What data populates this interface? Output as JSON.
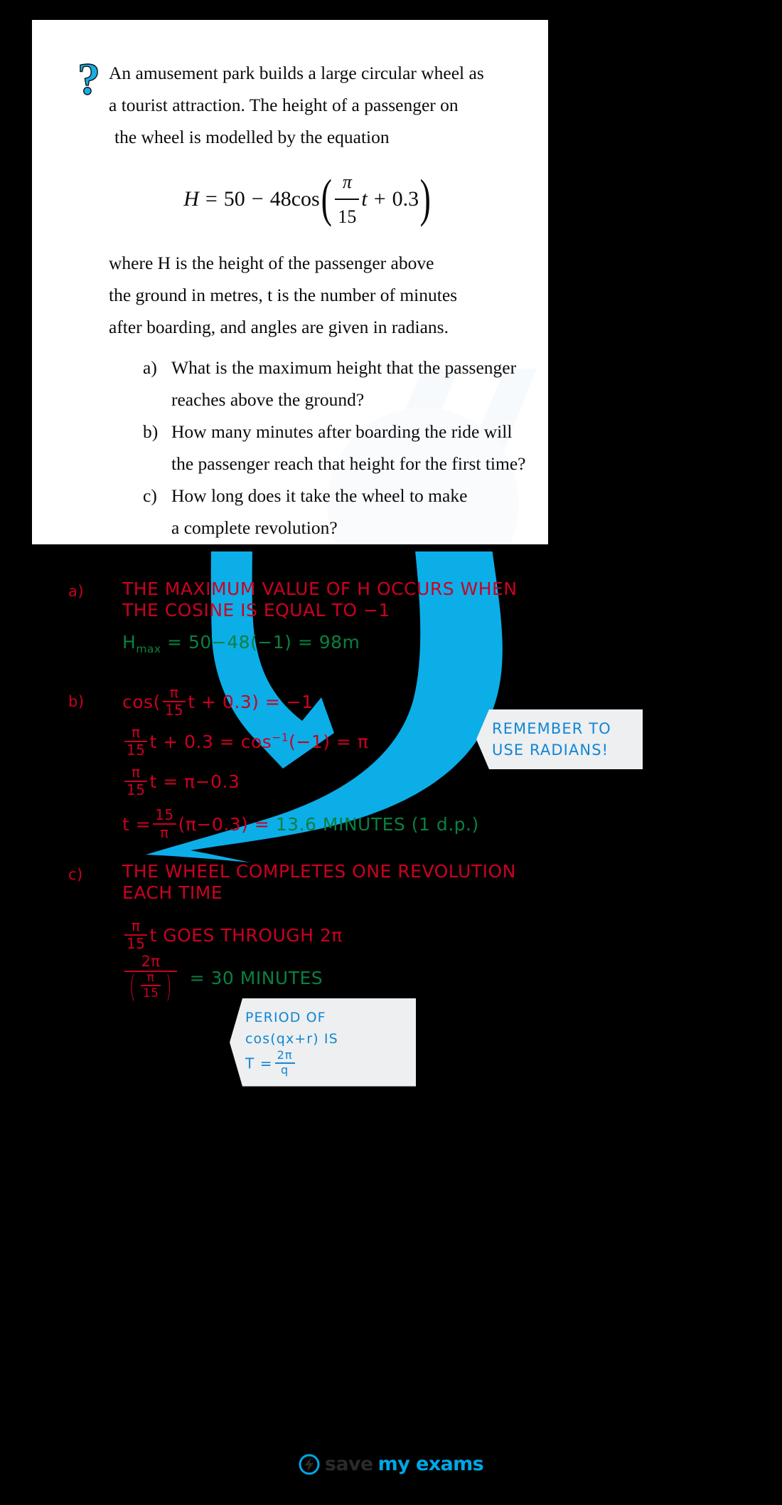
{
  "colors": {
    "background": "#000000",
    "card": "#ffffff",
    "accent_blue": "#00ACE6",
    "hand_red": "#CC0022",
    "hand_green": "#0A8040",
    "note_blue": "#1286D4",
    "note_bg": "#EDEFF0"
  },
  "question": {
    "icon": "question-mark-icon",
    "lines": [
      "An amusement park builds a large circular wheel as",
      "a tourist attraction.  The height of a passenger on",
      "the wheel is modelled by the equation"
    ],
    "equation": {
      "lhs": "H",
      "eq": "=",
      "const": "50",
      "minus": "−",
      "coeff": "48cos",
      "frac_num": "π",
      "frac_den": "15",
      "var": "t",
      "plus": "+",
      "phase": "0.3"
    },
    "lines2": [
      "where H is the height of the passenger above",
      "the ground in metres, t is the number of minutes",
      "after boarding, and angles are given in radians."
    ],
    "parts": [
      {
        "label": "a)",
        "lines": [
          "What is the maximum height that the passenger",
          "reaches above the ground?"
        ]
      },
      {
        "label": "b)",
        "lines": [
          "How many minutes after boarding the ride will",
          "the passenger reach that height for the first time?"
        ]
      },
      {
        "label": "c)",
        "lines": [
          "How long does it take the wheel to make",
          "a complete revolution?"
        ]
      }
    ]
  },
  "answers": {
    "a": {
      "label": "a)",
      "line1": "THE   MAXIMUM   VALUE   OF   H   OCCURS   WHEN",
      "line2": "THE   COSINE   IS   EQUAL   TO   −1",
      "result_lhs": "H",
      "result_sub": "max",
      "result_eq": "= 50−48(−1) =",
      "result_value": "98m"
    },
    "b": {
      "label": "b)",
      "step1_pre": "cos(",
      "step1_num": "π",
      "step1_den": "15",
      "step1_post": "t + 0.3) = −1",
      "step2_num": "π",
      "step2_den": "15",
      "step2_post": "t + 0.3 = cos",
      "step2_sup": "−1",
      "step2_tail": "(−1) = π",
      "step3_num": "π",
      "step3_den": "15",
      "step3_post": "t = π−0.3",
      "step4_pre": "t =",
      "step4_num": "15",
      "step4_den": "π",
      "step4_post": "(π−0.3) =",
      "step4_value": "13.6   MINUTES   (1  d.p.)"
    },
    "c": {
      "label": "c)",
      "line1": "THE   WHEEL   COMPLETES   ONE   REVOLUTION",
      "line2": "EACH   TIME",
      "step1_num": "π",
      "step1_den": "15",
      "step1_post": "t   GOES   THROUGH   2π",
      "step2_num": "2π",
      "step2_den_num": "π",
      "step2_den_den": "15",
      "step2_value": "= 30  MINUTES"
    }
  },
  "notes": [
    {
      "id": "radians-note",
      "line1": "REMEMBER   TO",
      "line2": "USE   RADIANS!"
    },
    {
      "id": "period-note",
      "line1": "PERIOD   OF   cos(qx+r)   IS",
      "line2_pre": "T =",
      "line2_num": "2π",
      "line2_den": "q"
    }
  ],
  "logo": {
    "icon": "lightning-bolt-icon",
    "word1": "save",
    "word2": "my exams"
  }
}
